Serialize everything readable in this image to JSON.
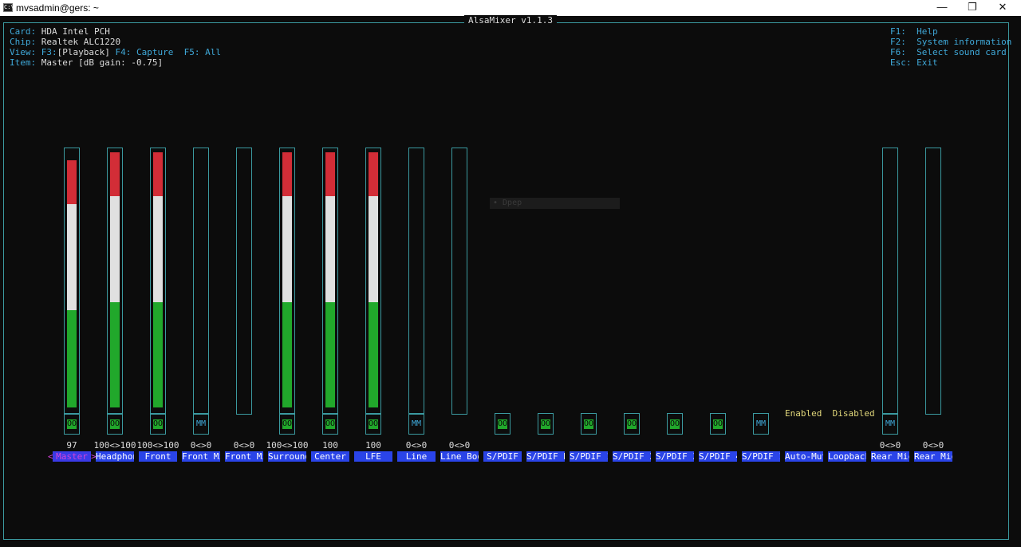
{
  "window": {
    "title": "mvsadmin@gers: ~",
    "icon_label": "C:\\",
    "minimize_glyph": "—",
    "maximize_glyph": "❐",
    "close_glyph": "✕"
  },
  "mixer": {
    "title": "AlsaMixer v1.1.3",
    "info": {
      "card_label": "Card:",
      "card_value": "HDA Intel PCH",
      "chip_label": "Chip:",
      "chip_value": "Realtek ALC1220",
      "view_label": "View:",
      "view_f3": "F3:",
      "view_playback": "[Playback]",
      "view_f4": "F4: Capture",
      "view_f5": "F5: All",
      "item_label": "Item:",
      "item_value": "Master [dB gain: -0.75]"
    },
    "help": {
      "f1_key": "F1:",
      "f1_action": "Help",
      "f2_key": "F2:",
      "f2_action": "System information",
      "f6_key": "F6:",
      "f6_action": "Select sound card",
      "esc_key": "Esc:",
      "esc_action": "Exit"
    },
    "enum_enabled": "Enabled",
    "enum_disabled": "Disabled",
    "ghost_text": "•  Dpep",
    "selector_left": "<",
    "selector_right": ">",
    "channels": [
      {
        "name": "Master",
        "value": "97",
        "level": 0.97,
        "switch": "OO",
        "has_strip": true,
        "selected": true
      },
      {
        "name": "Headphon",
        "value": "100<>100",
        "level": 1.0,
        "switch": "OO",
        "has_strip": true
      },
      {
        "name": "Front",
        "value": "100<>100",
        "level": 1.0,
        "switch": "OO",
        "has_strip": true
      },
      {
        "name": "Front Mi",
        "value": "0<>0",
        "level": 0,
        "switch": "MM",
        "has_strip": true
      },
      {
        "name": "Front Mi",
        "value": "0<>0",
        "level": 0,
        "switch": "",
        "has_strip": true
      },
      {
        "name": "Surround",
        "value": "100<>100",
        "level": 1.0,
        "switch": "OO",
        "has_strip": true
      },
      {
        "name": "Center",
        "value": "100",
        "level": 1.0,
        "switch": "OO",
        "has_strip": true
      },
      {
        "name": "LFE",
        "value": "100",
        "level": 1.0,
        "switch": "OO",
        "has_strip": true
      },
      {
        "name": "Line",
        "value": "0<>0",
        "level": 0,
        "switch": "MM",
        "has_strip": true
      },
      {
        "name": "Line Boo",
        "value": "0<>0",
        "level": 0,
        "switch": "",
        "has_strip": true
      },
      {
        "name": "S/PDIF",
        "value": "",
        "level": 0,
        "switch": "OO",
        "has_strip": false
      },
      {
        "name": "S/PDIF D",
        "value": "",
        "level": 0,
        "switch": "OO",
        "has_strip": false
      },
      {
        "name": "S/PDIF 1",
        "value": "",
        "level": 0,
        "switch": "OO",
        "has_strip": false
      },
      {
        "name": "S/PDIF 2",
        "value": "",
        "level": 0,
        "switch": "OO",
        "has_strip": false
      },
      {
        "name": "S/PDIF 3",
        "value": "",
        "level": 0,
        "switch": "OO",
        "has_strip": false
      },
      {
        "name": "S/PDIF 4",
        "value": "",
        "level": 0,
        "switch": "OO",
        "has_strip": false
      },
      {
        "name": "S/PDIF 1",
        "value": "",
        "level": 0,
        "switch": "MM",
        "has_strip": false
      },
      {
        "name": "Auto-Mut",
        "value": "",
        "level": 0,
        "switch": "",
        "has_strip": false
      },
      {
        "name": "Loopback",
        "value": "",
        "level": 0,
        "switch": "",
        "has_strip": false
      },
      {
        "name": "Rear Mic",
        "value": "0<>0",
        "level": 0,
        "switch": "MM",
        "has_strip": true
      },
      {
        "name": "Rear Mic",
        "value": "0<>0",
        "level": 0,
        "switch": "",
        "has_strip": true
      }
    ]
  }
}
